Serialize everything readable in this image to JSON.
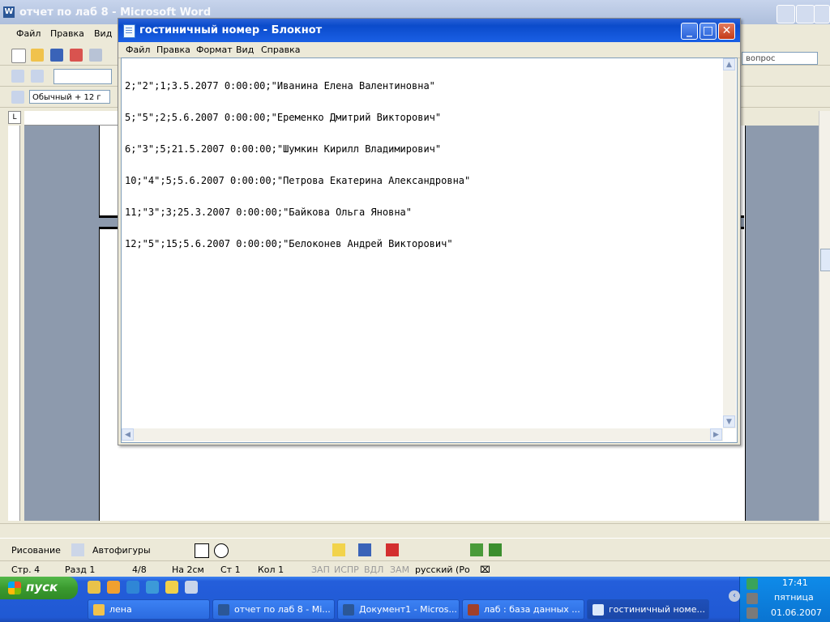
{
  "word": {
    "title": "отчет по лаб 8 - Microsoft Word",
    "menu": [
      "Файл",
      "Правка",
      "Вид"
    ],
    "help_box": "вопрос",
    "style_box": "Обычный + 12 г",
    "drawing": {
      "draw_label": "Рисование",
      "autoshapes_label": "Автофигуры"
    },
    "status": {
      "page": "Стр. 4",
      "section": "Разд 1",
      "pages": "4/8",
      "at": "На 2см",
      "line": "Ст 1",
      "col": "Кол 1",
      "rec": "ЗАП",
      "trk": "ИСПР",
      "ext": "ВДЛ",
      "ovr": "ЗАМ",
      "lang": "русский (Ро"
    }
  },
  "notepad": {
    "title": "гостиничный номер - Блокнот",
    "menu": [
      "Файл",
      "Правка",
      "Формат",
      "Вид",
      "Справка"
    ],
    "lines": [
      "2;\"2\";1;3.5.2077 0:00:00;\"Иванина Елена Валентиновна\"",
      "5;\"5\";2;5.6.2007 0:00:00;\"Еременко Дмитрий Викторович\"",
      "6;\"3\";5;21.5.2007 0:00:00;\"Шумкин Кирилл Владимирович\"",
      "10;\"4\";5;5.6.2007 0:00:00;\"Петрова Екатерина Александровна\"",
      "11;\"3\";3;25.3.2007 0:00:00;\"Байкова Ольга Яновна\"",
      "12;\"5\";15;5.6.2007 0:00:00;\"Белоконев Андрей Викторович\""
    ]
  },
  "taskbar": {
    "start": "пуск",
    "tasks": [
      "лена",
      "отчет по лаб 8 - Mi...",
      "Документ1 - Micros...",
      "лаб : база данных ...",
      "гостиничный номе..."
    ],
    "clock": {
      "time": "17:41",
      "day": "пятница",
      "date": "01.06.2007"
    }
  },
  "colors": {
    "taskbar": "#245edb",
    "start": "#3a9a2f",
    "titlebar": "#0b4bcb"
  }
}
